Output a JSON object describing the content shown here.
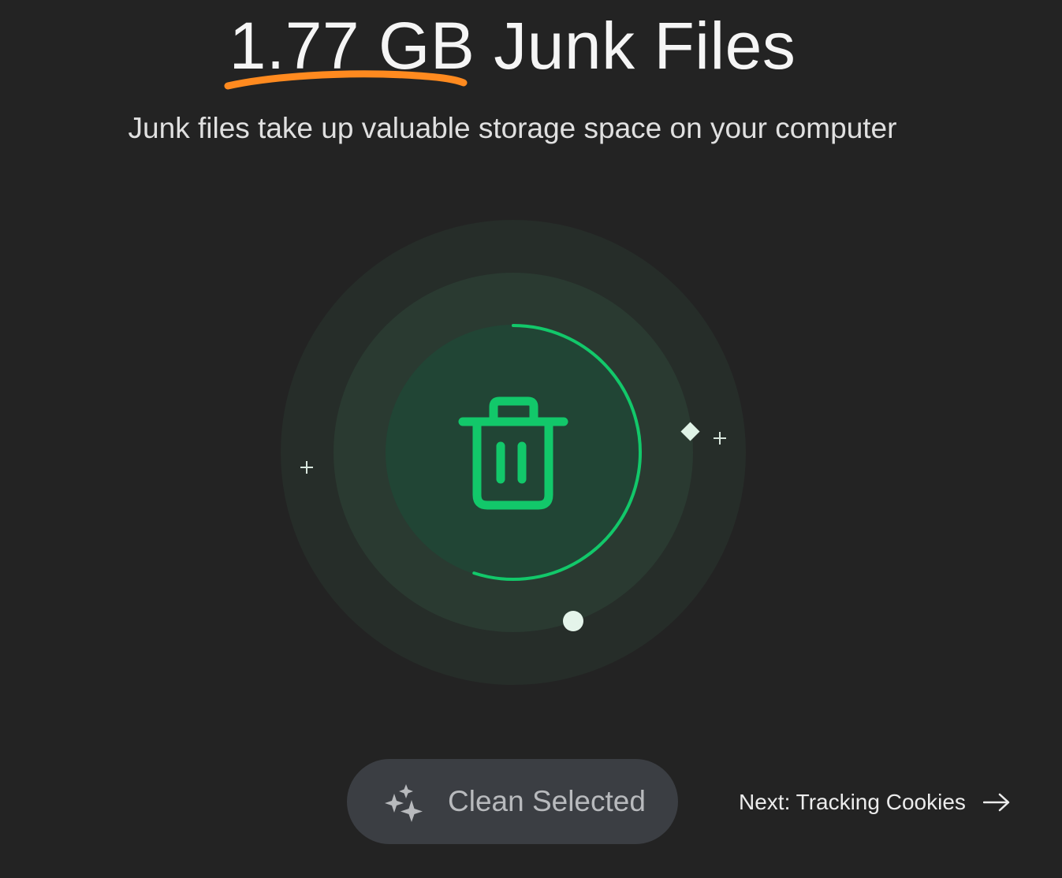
{
  "header": {
    "amount": "1.77 GB",
    "title_rest": " Junk Files",
    "subtitle": "Junk files take up valuable storage space on your computer"
  },
  "progress": {
    "fraction": 0.55
  },
  "actions": {
    "clean_label": "Clean Selected",
    "next_label": "Next: Tracking Cookies"
  },
  "colors": {
    "background": "#232323",
    "accent_green": "#12c86a",
    "underline_orange": "#ff8a1f",
    "button_bg": "#3b3e43",
    "button_text": "#b8babd"
  },
  "icons": {
    "center": "trash-icon",
    "button": "sparkle-icon",
    "next": "arrow-right-icon"
  }
}
